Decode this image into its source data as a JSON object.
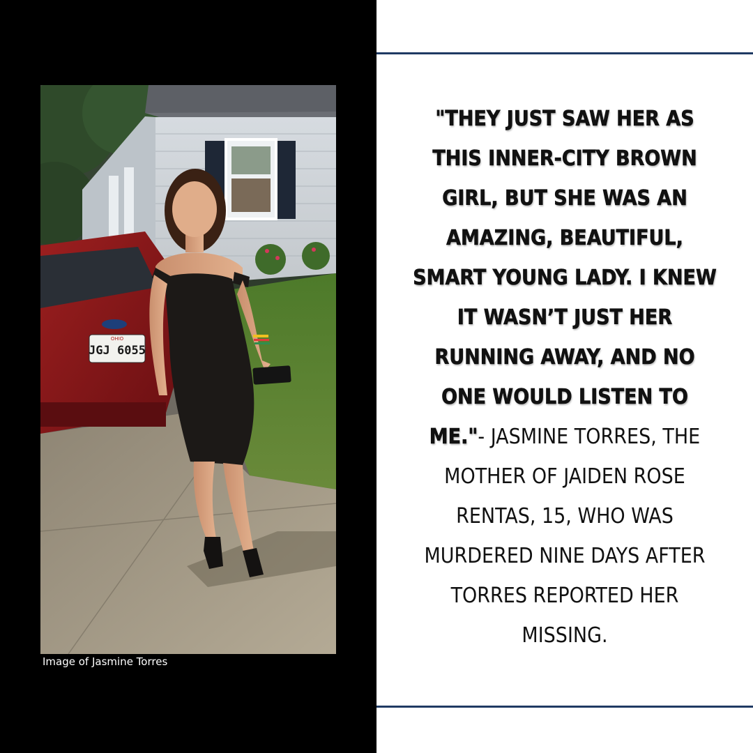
{
  "photo": {
    "icon": "portrait-photo",
    "license_plate_state": "OHIO",
    "license_plate": "JGJ 6055"
  },
  "caption": "Image of Jasmine Torres",
  "quote_text": "\"THEY JUST SAW HER AS THIS INNER-CITY BROWN GIRL, BUT SHE WAS AN AMAZING, BEAUTIFUL, SMART YOUNG LADY. I KNEW IT WASN’T JUST HER RUNNING AWAY, AND NO ONE WOULD LISTEN TO ME.\"",
  "attribution_text": "- JASMINE TORRES, THE MOTHER OF JAIDEN ROSE RENTAS, 15, WHO WAS MURDERED NINE DAYS AFTER TORRES REPORTED HER MISSING.",
  "colors": {
    "left_panel": "#000000",
    "background": "#ffffff",
    "rule": "#1f3a63",
    "text": "#111111"
  }
}
